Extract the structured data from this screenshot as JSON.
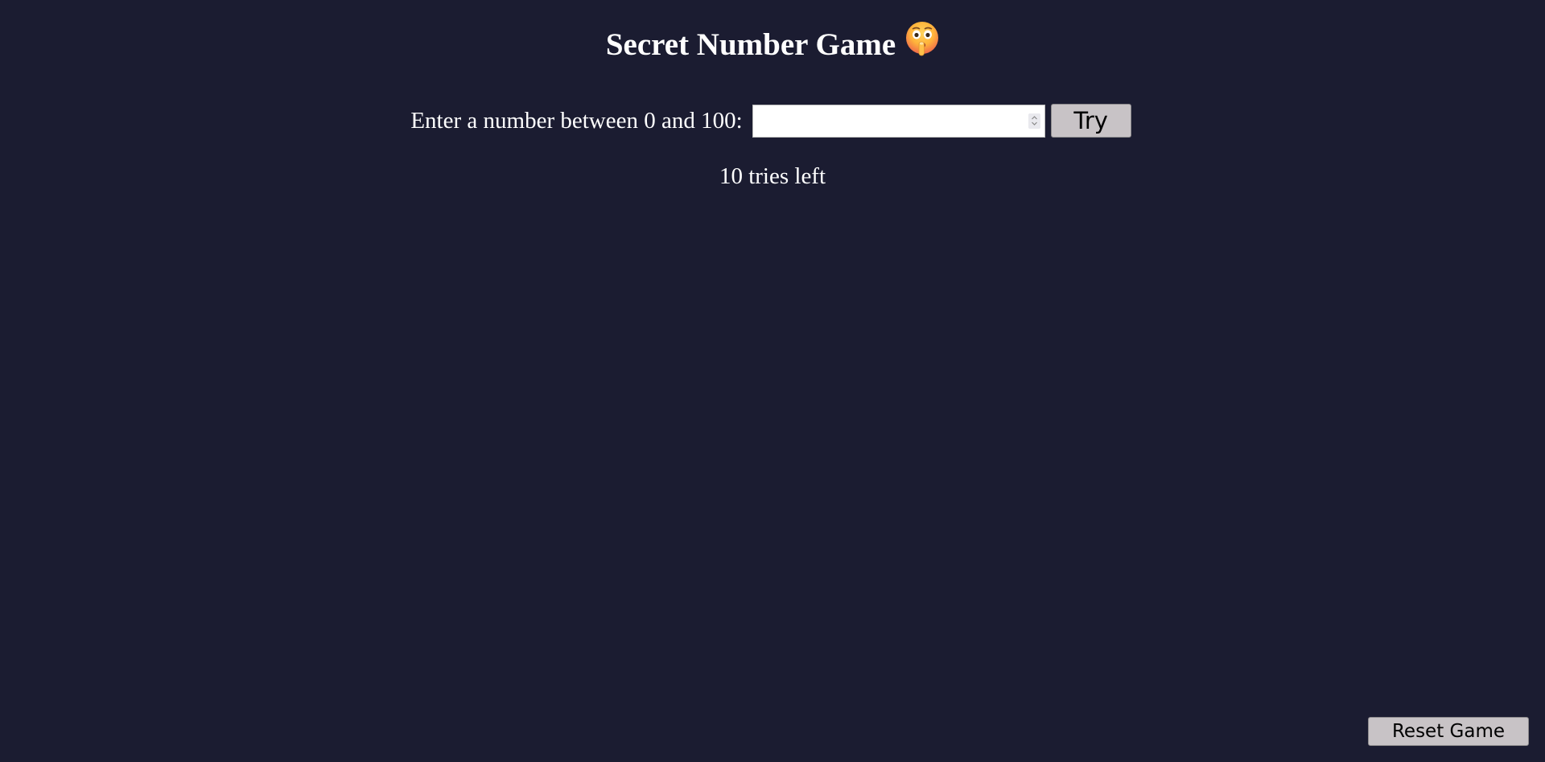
{
  "game": {
    "title": "Secret Number Game",
    "title_emoji_icon": "shushing-face-icon",
    "prompt_label": "Enter a number between 0 and 100:",
    "input_value": "",
    "try_label": "Try",
    "tries_left_text": "10 tries left",
    "reset_label": "Reset Game"
  },
  "colors": {
    "background": "#1b1c31",
    "text": "#ffffff",
    "button_bg": "#c8c3c6",
    "input_bg": "#ffffff"
  }
}
